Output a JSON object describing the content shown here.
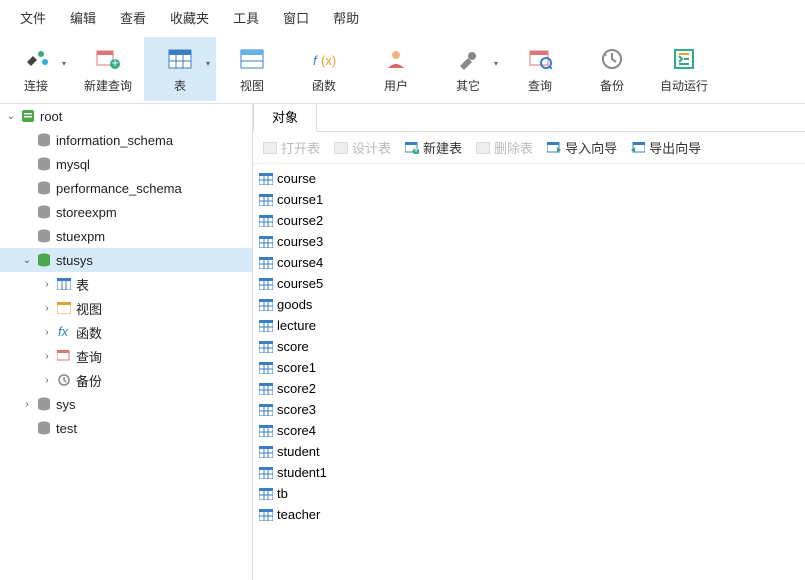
{
  "menu": {
    "file": "文件",
    "edit": "编辑",
    "view": "查看",
    "favorites": "收藏夹",
    "tools": "工具",
    "window": "窗口",
    "help": "帮助"
  },
  "toolbar": {
    "connect": "连接",
    "new_query": "新建查询",
    "table": "表",
    "view": "视图",
    "function": "函数",
    "user": "用户",
    "other": "其它",
    "query": "查询",
    "backup": "备份",
    "autorun": "自动运行"
  },
  "tree": {
    "root": "root",
    "databases": [
      "information_schema",
      "mysql",
      "performance_schema",
      "storeexpm",
      "stuexpm"
    ],
    "selected_db": "stusys",
    "selected_children": {
      "table": "表",
      "view": "视图",
      "function": "函数",
      "query": "查询",
      "backup": "备份"
    },
    "other_dbs": [
      "sys",
      "test"
    ]
  },
  "tab": {
    "object": "对象"
  },
  "actions": {
    "open": "打开表",
    "design": "设计表",
    "new": "新建表",
    "delete": "删除表",
    "import": "导入向导",
    "export": "导出向导"
  },
  "tables": [
    "course",
    "course1",
    "course2",
    "course3",
    "course4",
    "course5",
    "goods",
    "lecture",
    "score",
    "score1",
    "score2",
    "score3",
    "score4",
    "student",
    "student1",
    "tb",
    "teacher"
  ]
}
